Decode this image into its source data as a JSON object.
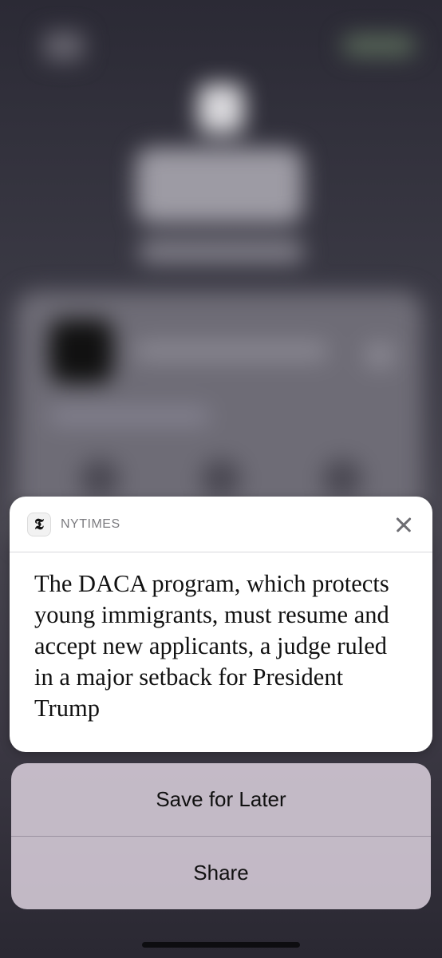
{
  "notification": {
    "app_icon": "nytimes-logo-icon",
    "app_icon_glyph": "𝕿",
    "app_name": "NYTIMES",
    "close_icon": "close-icon",
    "body": "The DACA program, which protects young immigrants, must resume and accept new applicants, a judge ruled in a major setback for President Trump"
  },
  "actions": [
    {
      "label": "Save for Later"
    },
    {
      "label": "Share"
    }
  ],
  "colors": {
    "card_background": "#ffffff",
    "action_sheet_background": "#d7cdda",
    "text": "#111111",
    "app_name": "#7c7c80"
  }
}
